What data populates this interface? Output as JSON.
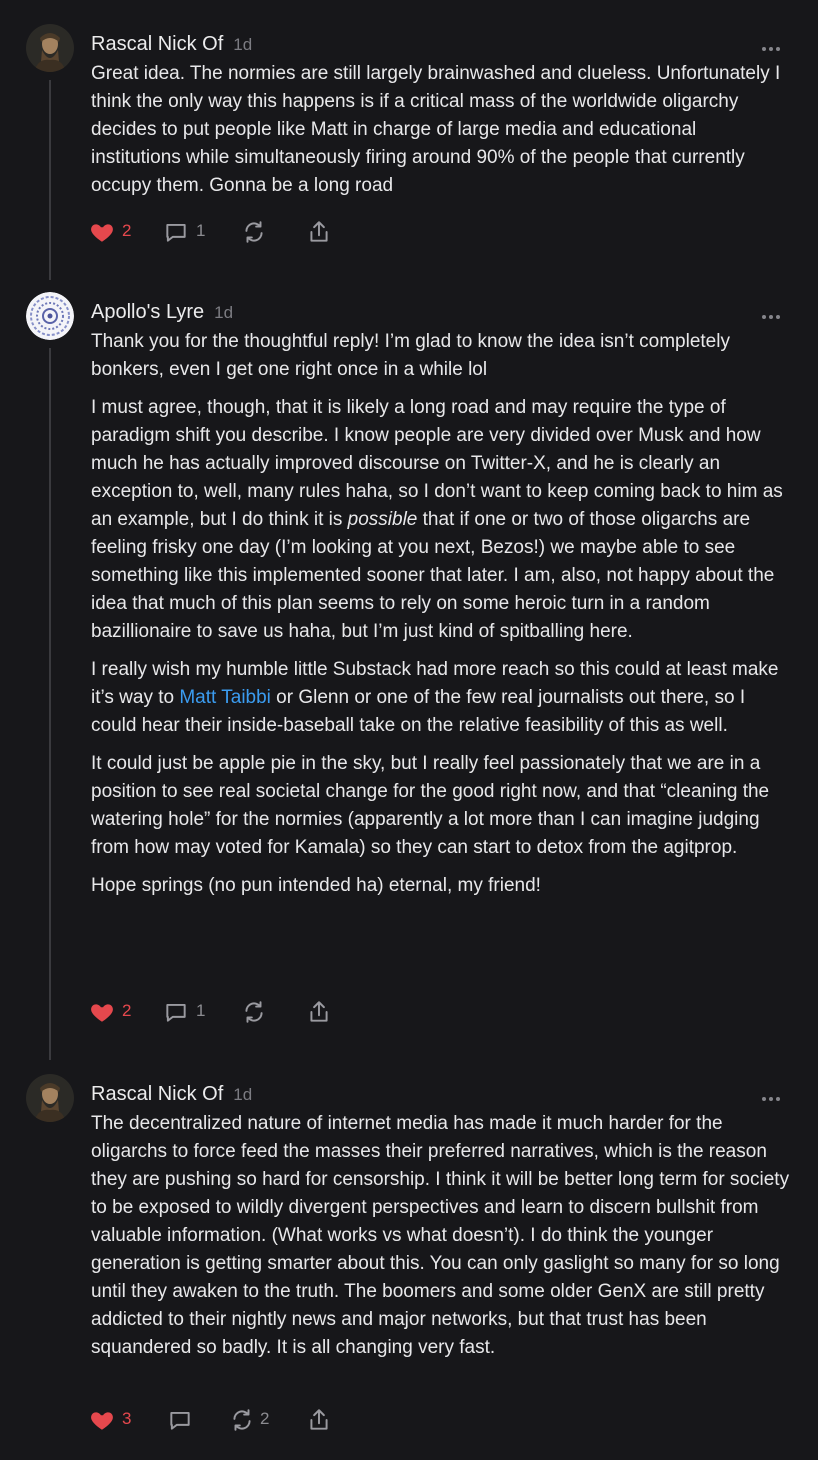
{
  "comments": [
    {
      "author": "Rascal Nick Of",
      "time": "1d",
      "paragraphs": [
        "Great idea. The normies are still largely brainwashed and clueless. Unfortunately I think the only way this happens is if a critical mass of the worldwide oligarchy decides to put people like Matt in charge of large media and educational institutions while simultaneously firing around 90% of the people that currently occupy them. Gonna be a long road"
      ],
      "likes": "2",
      "replies": "1",
      "restacks": ""
    },
    {
      "author": "Apollo's Lyre",
      "time": "1d",
      "p1": "Thank you for the thoughtful reply! I’m glad to know the idea isn’t completely bonkers, even I get one right once in a while lol",
      "p2_a": "I must agree, though, that it is likely a long road and may require the type of paradigm shift you describe. I know people are very divided over Musk and how much he has actually improved discourse on Twitter-X, and he is clearly an exception to, well, many rules haha, so I don’t want to keep coming back to him as an example, but I do think it is ",
      "p2_em": "possible",
      "p2_b": " that if one or two of those oligarchs are feeling frisky one day (I’m looking at you next, Bezos!) we maybe able to see something like this implemented sooner that later. I am, also, not happy about the idea that much of this plan seems to rely on some heroic turn in a random bazillionaire to save us haha, but I’m just kind of spitballing here.",
      "p3_a": "I really wish my humble little Substack had more reach so this could at least make it’s way to ",
      "p3_link": "Matt Taibbi",
      "p3_b": " or Glenn or one of the few real journalists out there, so I could hear their inside-baseball take on the relative feasibility of this as well.",
      "p4": "It could just be apple pie in the sky, but I really feel passionately that we are in a position to see real societal change for the good right now, and that “cleaning the watering hole” for the normies (apparently a lot more than I can imagine judging from how may voted for Kamala) so they can start to detox from the agitprop.",
      "p5": "Hope springs (no pun intended ha) eternal, my friend!",
      "likes": "2",
      "replies": "1",
      "restacks": ""
    },
    {
      "author": "Rascal Nick Of",
      "time": "1d",
      "paragraphs": [
        "The decentralized nature of internet media has made it much harder for the oligarchs to force feed the masses their preferred narratives, which is the reason they are pushing so hard for censorship. I think it will be better long term for society to be exposed to wildly divergent perspectives and learn to discern bullshit from valuable information. (What works vs what doesn’t). I do think the younger generation is getting smarter about this. You can only gaslight so many for so long until they awaken to the truth. The boomers and some older GenX are still pretty addicted to their nightly news and major networks, but that trust has been squandered so badly. It is all changing very fast."
      ],
      "likes": "3",
      "replies": "",
      "restacks": "2"
    }
  ],
  "icons": {
    "like": "heart-icon",
    "reply": "comment-bubble-icon",
    "restack": "restack-icon",
    "share": "share-icon",
    "more": "more-dots-icon"
  },
  "colors": {
    "background": "#17171a",
    "like": "#e5484d",
    "link": "#3b9cf0",
    "muted": "#8b8b90"
  }
}
